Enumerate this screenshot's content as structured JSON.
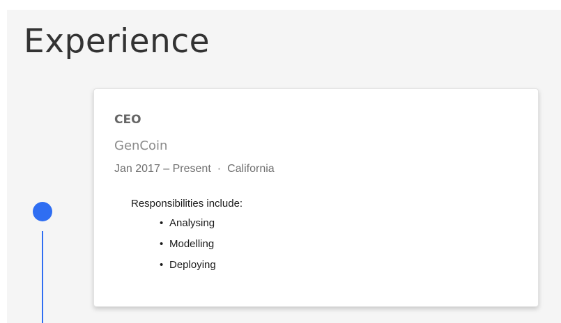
{
  "section": {
    "title": "Experience"
  },
  "experience": [
    {
      "role": "CEO",
      "company": "GenCoin",
      "dates": "Jan 2017 – Present",
      "separator": "·",
      "location": "California",
      "description_intro": "Responsibilities include:",
      "responsibilities": [
        "Analysing",
        "Modelling",
        "Deploying"
      ]
    }
  ],
  "colors": {
    "accent": "#2f6ef2",
    "background": "#f5f5f5",
    "card": "#ffffff"
  }
}
